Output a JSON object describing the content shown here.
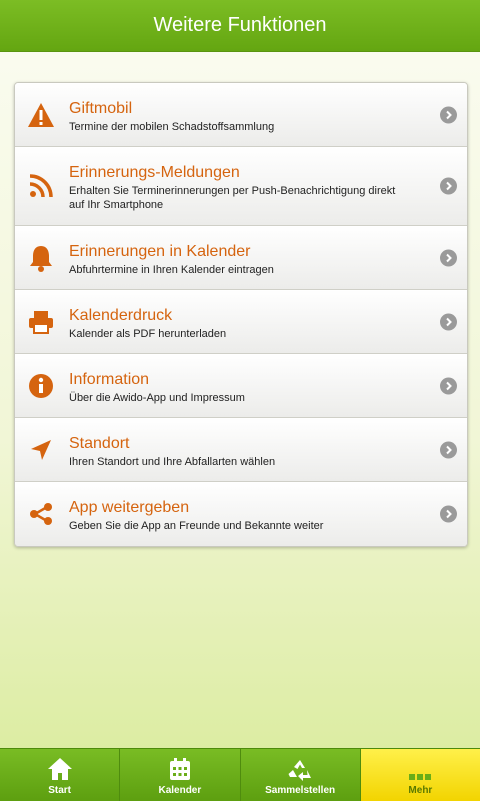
{
  "header": {
    "title": "Weitere Funktionen"
  },
  "items": [
    {
      "icon": "warning-icon",
      "title": "Giftmobil",
      "subtitle": "Termine der mobilen Schadstoffsammlung"
    },
    {
      "icon": "rss-icon",
      "title": "Erinnerungs-Meldungen",
      "subtitle": "Erhalten Sie Terminerinnerungen per Push-Benachrichtigung direkt auf Ihr Smartphone"
    },
    {
      "icon": "bell-icon",
      "title": "Erinnerungen in Kalender",
      "subtitle": "Abfuhrtermine in Ihren Kalender eintragen"
    },
    {
      "icon": "printer-icon",
      "title": "Kalenderdruck",
      "subtitle": "Kalender als PDF herunterladen"
    },
    {
      "icon": "info-icon",
      "title": "Information",
      "subtitle": "Über die Awido-App und Impressum"
    },
    {
      "icon": "location-arrow-icon",
      "title": "Standort",
      "subtitle": "Ihren Standort und Ihre Abfallarten wählen"
    },
    {
      "icon": "share-icon",
      "title": "App weitergeben",
      "subtitle": "Geben Sie die App an Freunde und Bekannte weiter"
    }
  ],
  "tabs": [
    {
      "icon": "home-icon",
      "label": "Start",
      "active": false
    },
    {
      "icon": "calendar-icon",
      "label": "Kalender",
      "active": false
    },
    {
      "icon": "recycle-icon",
      "label": "Sammelstellen",
      "active": false
    },
    {
      "icon": "more-icon",
      "label": "Mehr",
      "active": true
    }
  ],
  "colors": {
    "accent": "#d5640f",
    "header": "#6aad18",
    "active_tab": "#f5dc10"
  }
}
